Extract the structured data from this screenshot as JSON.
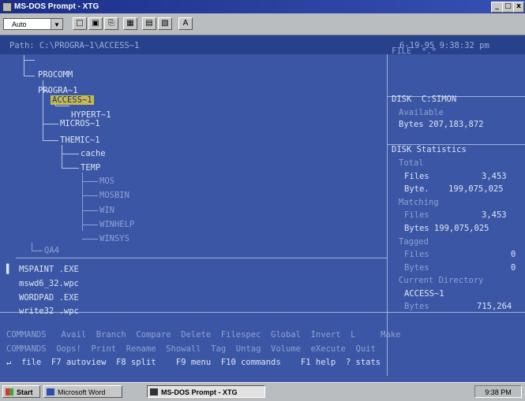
{
  "window": {
    "title": "MS-DOS Prompt - XTG",
    "min": "_",
    "max": "□",
    "close": "x"
  },
  "toolbar": {
    "font_size": "Auto",
    "buttons": [
      "□",
      "▣",
      "⎘",
      "▦",
      "▤",
      "▧",
      "A"
    ]
  },
  "pathbar": {
    "path": "Path: C:\\PROGRA~1\\ACCESS~1",
    "datetime": "6-19-95  9:38:32 pm"
  },
  "tree": [
    "PROCOMM",
    "PROGRA~1",
    "ACCESS~1",
    "HYPERT~1",
    "MICROS~1",
    "THEMIC~1",
    "cache",
    "TEMP",
    "MOS",
    "MOSBIN",
    "WIN",
    "WINHELP",
    "WINSYS",
    "QA4"
  ],
  "files": [
    "MSPAINT .EXE",
    "mswd6_32.wpc",
    "WORDPAD .EXE",
    "write32 .wpc"
  ],
  "info": {
    "file_label": "FILE  *.*",
    "disk_label": "DISK  C:SIMON",
    "available": "Available",
    "avail_bytes": "Bytes 207,183,872",
    "stats_title": "DISK Statistics",
    "total": "Total",
    "total_files_label": "Files",
    "total_files": "3,453",
    "total_bytes_label": "Byte.",
    "total_bytes": "199,075,025",
    "matching": "Matching",
    "match_files_label": "Files",
    "match_files": "3,453",
    "match_bytes": "Bytes 199,075,025",
    "tagged": "Tagged",
    "tag_files_label": "Files",
    "tag_files": "0",
    "tag_bytes_label": "Bytes",
    "tag_bytes": "0",
    "current_dir": "Current Directory",
    "cur_name": "ACCESS~1",
    "cur_bytes_label": "Bytes",
    "cur_bytes": "715,264"
  },
  "menu": {
    "row1": "COMMANDS   Avail  Branch  Compare  Delete  Filespec  Global  Invert  L     Make",
    "row2": "COMMANDS  Oops!  Print  Rename  Showall  Tag  Untag  Volume  eXecute  Quit",
    "row3": "↵  file  F7 autoview  F8 split    F9 menu  F10 commands    F1 help  ? stats"
  },
  "taskbar": {
    "start": "Start",
    "word": "Microsoft Word",
    "dos": "MS-DOS Prompt - XTG",
    "clock": "9:38 PM"
  }
}
